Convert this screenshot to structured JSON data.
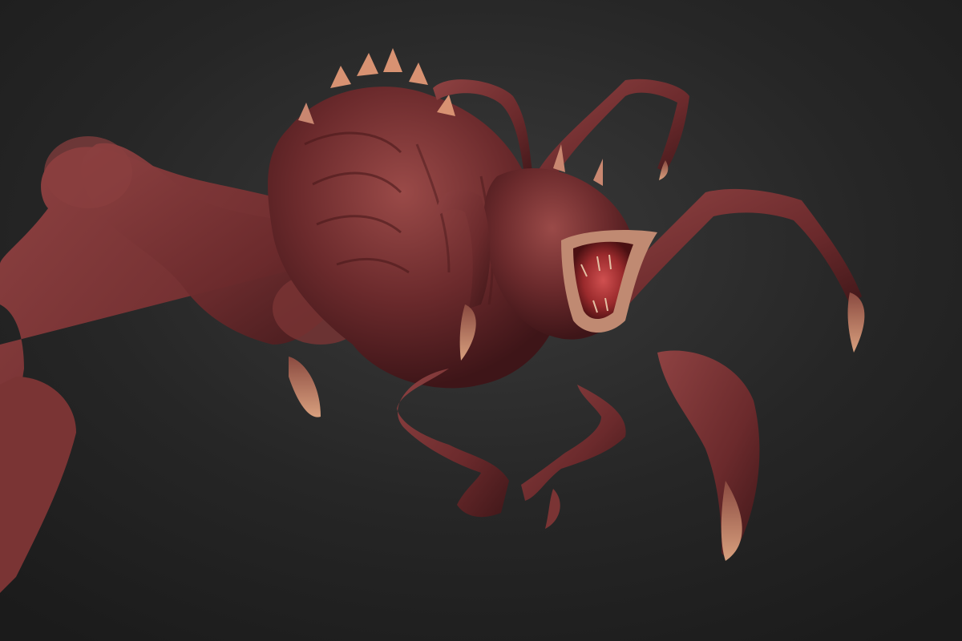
{
  "scene": {
    "background_top": "#3a3a3a",
    "background_mid": "#262626",
    "background_bottom": "#1b1b1b",
    "skin_base": "#6b2a2c",
    "skin_highlight": "#9a4a48",
    "skin_shadow": "#3e1518",
    "spike_color": "#d89272",
    "claw_color": "#c98770",
    "mouth_inner": "#9a2a2c",
    "mouth_lip": "#c08a72"
  }
}
